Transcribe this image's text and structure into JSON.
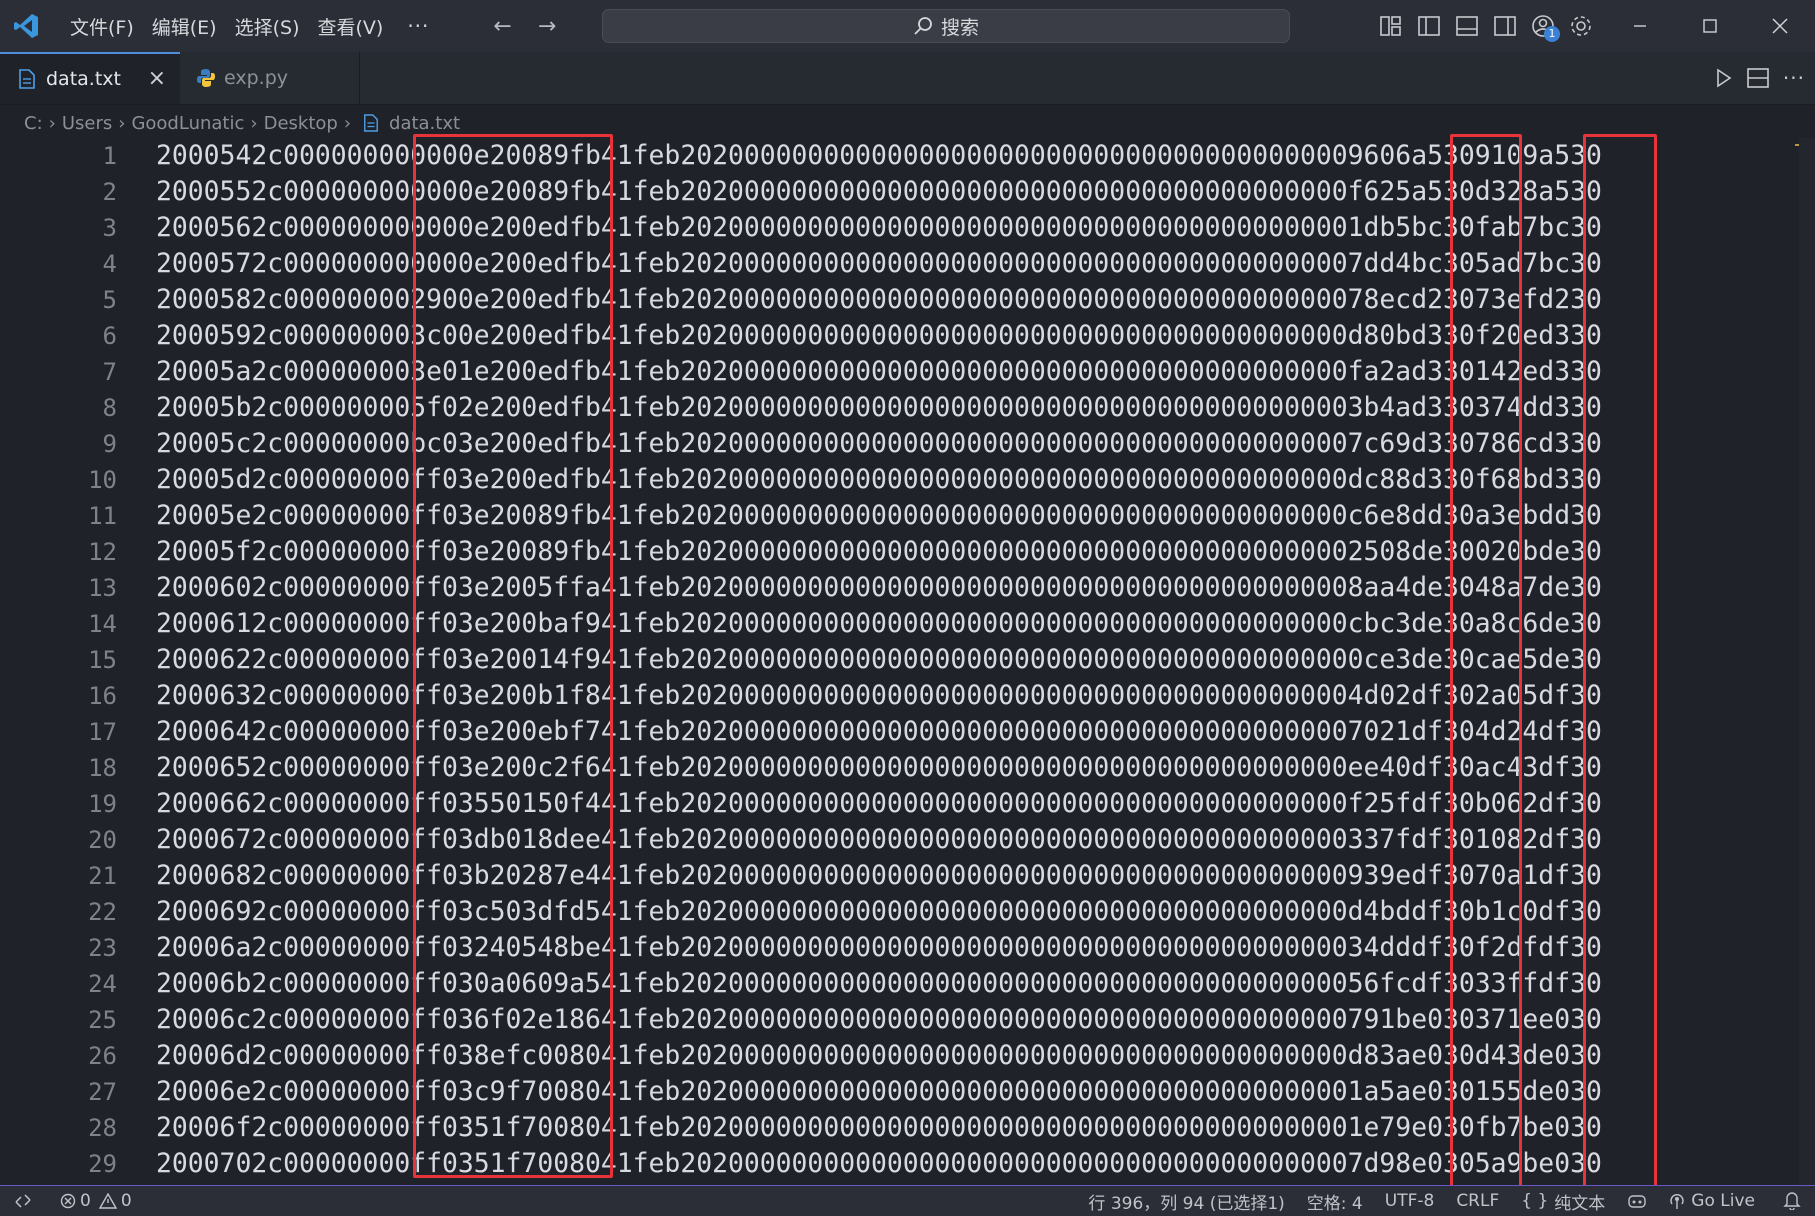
{
  "menu": {
    "file": "文件(F)",
    "edit": "编辑(E)",
    "selection": "选择(S)",
    "view": "查看(V)",
    "more": "···"
  },
  "search": {
    "label": "搜索"
  },
  "tabs": [
    {
      "label": "data.txt",
      "active": true
    },
    {
      "label": "exp.py",
      "active": false
    }
  ],
  "breadcrumb": [
    "C:",
    "Users",
    "GoodLunatic",
    "Desktop",
    "data.txt"
  ],
  "account_badge": "1",
  "editor": {
    "lines": [
      {
        "n": "1",
        "text": "2000542c000000000000e20089fb41feb2020000000000000000000000000000000000000009606a5309109a530"
      },
      {
        "n": "2",
        "text": "2000552c000000000000e20089fb41feb202000000000000000000000000000000000000000f625a530d328a530"
      },
      {
        "n": "3",
        "text": "2000562c000000000000e200edfb41feb2020000000000000000000000000000000000000001db5bc30fab7bc30"
      },
      {
        "n": "4",
        "text": "2000572c000000000000e200edfb41feb2020000000000000000000000000000000000000007dd4bc305ad7bc30"
      },
      {
        "n": "5",
        "text": "2000582c000000002900e200edfb41feb20200000000000000000000000000000000000000078ecd23073efd230"
      },
      {
        "n": "6",
        "text": "2000592c000000003c00e200edfb41feb202000000000000000000000000000000000000000d80bd330f20ed330"
      },
      {
        "n": "7",
        "text": "20005a2c000000003e01e200edfb41feb202000000000000000000000000000000000000000fa2ad330142ed330"
      },
      {
        "n": "8",
        "text": "20005b2c000000005f02e200edfb41feb2020000000000000000000000000000000000000003b4ad330374dd330"
      },
      {
        "n": "9",
        "text": "20005c2c00000000bc03e200edfb41feb2020000000000000000000000000000000000000007c69d330786cd330"
      },
      {
        "n": "10",
        "text": "20005d2c00000000ff03e200edfb41feb202000000000000000000000000000000000000000dc88d330f68bd330"
      },
      {
        "n": "11",
        "text": "20005e2c00000000ff03e20089fb41feb202000000000000000000000000000000000000000c6e8dd30a3ebdd30"
      },
      {
        "n": "12",
        "text": "20005f2c00000000ff03e20089fb41feb2020000000000000000000000000000000000000002508de30020bde30"
      },
      {
        "n": "13",
        "text": "2000602c00000000ff03e2005ffa41feb2020000000000000000000000000000000000000008aa4de3048a7de30"
      },
      {
        "n": "14",
        "text": "2000612c00000000ff03e200baf941feb202000000000000000000000000000000000000000cbc3de30a8c6de30"
      },
      {
        "n": "15",
        "text": "2000622c00000000ff03e20014f941feb2020000000000000000000000000000000000000000ce3de30cae5de30"
      },
      {
        "n": "16",
        "text": "2000632c00000000ff03e200b1f841feb2020000000000000000000000000000000000000004d02df302a05df30"
      },
      {
        "n": "17",
        "text": "2000642c00000000ff03e200ebf741feb2020000000000000000000000000000000000000007021df304d24df30"
      },
      {
        "n": "18",
        "text": "2000652c00000000ff03e200c2f641feb202000000000000000000000000000000000000000ee40df30ac43df30"
      },
      {
        "n": "19",
        "text": "2000662c00000000ff03550150f441feb202000000000000000000000000000000000000000f25fdf30b062df30"
      },
      {
        "n": "20",
        "text": "2000672c00000000ff03db018dee41feb202000000000000000000000000000000000000000337fdf301082df30"
      },
      {
        "n": "21",
        "text": "2000682c00000000ff03b20287e441feb202000000000000000000000000000000000000000939edf3070a1df30"
      },
      {
        "n": "22",
        "text": "2000692c00000000ff03c503dfd541feb202000000000000000000000000000000000000000d4bddf30b1c0df30"
      },
      {
        "n": "23",
        "text": "20006a2c00000000ff03240548be41feb20200000000000000000000000000000000000000034dddf30f2dfdf30"
      },
      {
        "n": "24",
        "text": "20006b2c00000000ff030a0609a541feb20200000000000000000000000000000000000000056fcdf3033ffdf30"
      },
      {
        "n": "25",
        "text": "20006c2c00000000ff036f02e18641feb202000000000000000000000000000000000000000791be030371ee030"
      },
      {
        "n": "26",
        "text": "20006d2c00000000ff038efc008041feb202000000000000000000000000000000000000000d83ae030d43de030"
      },
      {
        "n": "27",
        "text": "20006e2c00000000ff03c9f7008041feb2020000000000000000000000000000000000000001a5ae030155de030"
      },
      {
        "n": "28",
        "text": "20006f2c00000000ff0351f7008041feb2020000000000000000000000000000000000000001e79e030fb7be030"
      },
      {
        "n": "29",
        "text": "2000702c00000000ff0351f7008041feb2020000000000000000000000000000000000000007d98e0305a9be030"
      }
    ]
  },
  "statusbar": {
    "errors": "0",
    "warnings": "0",
    "cursor": "行 396，列 94 (已选择1)",
    "spaces": "空格: 4",
    "encoding": "UTF-8",
    "eol": "CRLF",
    "language": "纯文本",
    "golive": "Go Live"
  },
  "colors": {
    "accent": "#4e8cde",
    "highlight_box": "#e8333a",
    "status_border": "#6a57c8"
  }
}
